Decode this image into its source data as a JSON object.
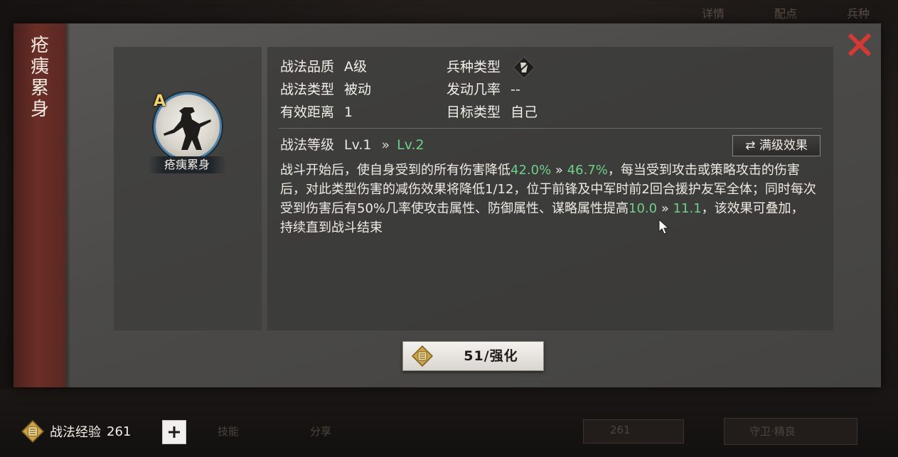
{
  "background": {
    "top_tabs": [
      "详情",
      "配点",
      "兵种"
    ],
    "bottom_items": [
      "技能",
      "分享"
    ],
    "bottom_value": "261",
    "bottom_button": "守卫·精良"
  },
  "dialog": {
    "side_title": "疮痍累身",
    "close_icon": "close-x-icon",
    "skill": {
      "grade": "A",
      "name": "疮痍累身"
    },
    "attributes": {
      "quality_label": "战法品质",
      "quality_value": "A级",
      "troop_label": "兵种类型",
      "troop_icon": "troop-type-icon",
      "type_label": "战法类型",
      "type_value": "被动",
      "rate_label": "发动几率",
      "rate_value": "--",
      "range_label": "有效距离",
      "range_value": "1",
      "target_label": "目标类型",
      "target_value": "自己"
    },
    "level": {
      "label": "战法等级",
      "current": "Lv.1",
      "arrow": "»",
      "next": "Lv.2",
      "max_button": "满级效果",
      "max_icon": "swap-arrows-icon"
    },
    "description": {
      "p1": "战斗开始后，使自身受到的所有伤害降低",
      "v1_old": "42.0%",
      "arrow": "»",
      "v1_new": "46.7%",
      "p2": "，每当受到攻击或策略攻击的伤害后，对此类型伤害的减伤效果将降低1/12，位于前锋及中军时前2回合援护友军全体；同时每次受到伤害后有50%几率使攻击属性、防御属性、谋略属性提高",
      "v2_old": "10.0",
      "v2_new": "11.1",
      "p3": "，该效果可叠加，持续直到战斗结束"
    },
    "upgrade_button": "51/强化"
  },
  "footer": {
    "exp_label": "战法经验",
    "exp_value": "261",
    "plus": "+"
  },
  "colors": {
    "accent_green": "#6fcf8a",
    "close_red": "#d23a33",
    "banner": "#6b2e27"
  }
}
